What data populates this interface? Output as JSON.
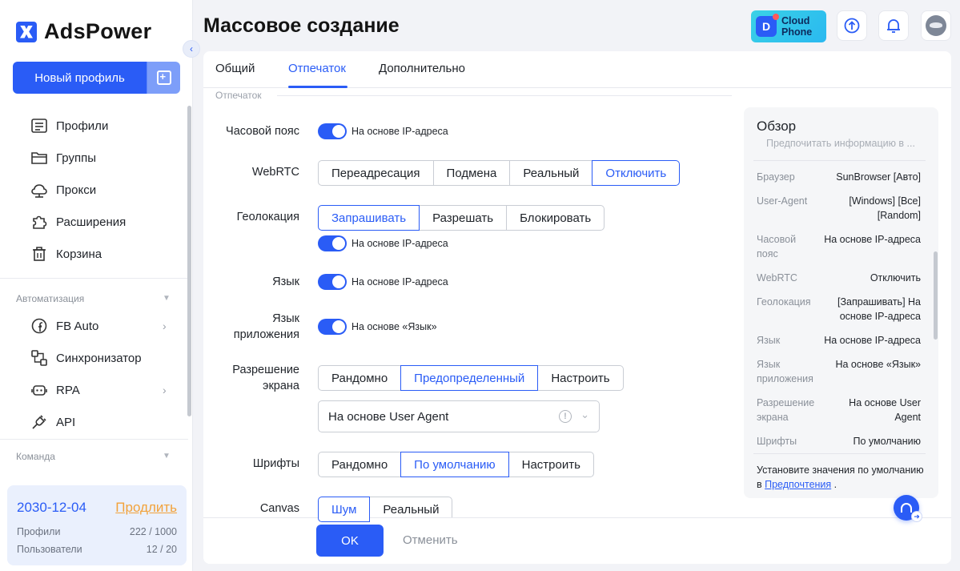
{
  "brand": {
    "name": "AdsPower"
  },
  "sidebar": {
    "new_profile_label": "Новый профиль",
    "items": [
      {
        "label": "Профили",
        "icon": "profiles-icon"
      },
      {
        "label": "Группы",
        "icon": "folder-icon"
      },
      {
        "label": "Прокси",
        "icon": "proxy-icon"
      },
      {
        "label": "Расширения",
        "icon": "puzzle-icon"
      },
      {
        "label": "Корзина",
        "icon": "trash-icon"
      }
    ],
    "automation_label": "Автоматизация",
    "automation_items": [
      {
        "label": "FB Auto",
        "icon": "facebook-icon"
      },
      {
        "label": "Синхронизатор",
        "icon": "sync-icon"
      },
      {
        "label": "RPA",
        "icon": "robot-icon"
      },
      {
        "label": "API",
        "icon": "plug-icon"
      }
    ],
    "team_label": "Команда",
    "plan": {
      "date": "2030-12-04",
      "renew": "Продлить",
      "profiles_label": "Профили",
      "profiles_value": "222 / 1000",
      "users_label": "Пользователи",
      "users_value": "12 / 20"
    }
  },
  "header": {
    "title": "Массовое создание",
    "cloud_phone_line1": "Cloud",
    "cloud_phone_line2": "Phone"
  },
  "tabs": [
    {
      "label": "Общий"
    },
    {
      "label": "Отпечаток",
      "active": true
    },
    {
      "label": "Дополнительно"
    }
  ],
  "section_legend": "Отпечаток",
  "form": {
    "timezone": {
      "label": "Часовой пояс",
      "toggle_label": "На основе IP-адреса",
      "on": true
    },
    "webrtc": {
      "label": "WebRTC",
      "options": [
        "Переадресация",
        "Подмена",
        "Реальный",
        "Отключить"
      ],
      "selected": "Отключить"
    },
    "geolocation": {
      "label": "Геолокация",
      "options": [
        "Запрашивать",
        "Разрешать",
        "Блокировать"
      ],
      "selected": "Запрашивать",
      "toggle_label": "На основе IP-адреса",
      "on": true
    },
    "language": {
      "label": "Язык",
      "toggle_label": "На основе IP-адреса",
      "on": true
    },
    "app_language": {
      "label_line1": "Язык",
      "label_line2": "приложения",
      "toggle_label": "На основе «Язык»",
      "on": true
    },
    "resolution": {
      "label_line1": "Разрешение",
      "label_line2": "экрана",
      "options": [
        "Рандомно",
        "Предопределенный",
        "Настроить"
      ],
      "selected": "Предопределенный",
      "select_value": "На основе User Agent"
    },
    "fonts": {
      "label": "Шрифты",
      "options": [
        "Рандомно",
        "По умолчанию",
        "Настроить"
      ],
      "selected": "По умолчанию"
    },
    "canvas": {
      "label": "Canvas",
      "options": [
        "Шум",
        "Реальный"
      ],
      "selected": "Шум"
    }
  },
  "overview": {
    "title": "Обзор",
    "search_placeholder": "Предпочитать информацию в ...",
    "rows": [
      {
        "key": "Браузер",
        "value": "SunBrowser [Авто]"
      },
      {
        "key": "User-Agent",
        "value": "[Windows] [Все] [Random]"
      },
      {
        "key": "Часовой пояс",
        "value": "На основе IP-адреса"
      },
      {
        "key": "WebRTC",
        "value": "Отключить"
      },
      {
        "key": "Геолокация",
        "value": "[Запрашивать] На основе IP-адреса"
      },
      {
        "key": "Язык",
        "value": "На основе IP-адреса"
      },
      {
        "key": "Язык приложения",
        "value": "На основе «Язык»"
      },
      {
        "key": "Разрешение экрана",
        "value": "На основе User Agent"
      },
      {
        "key": "Шрифты",
        "value": "По умолчанию"
      }
    ],
    "note_text": "Установите значения по умолчанию в",
    "note_link": "Предпочтения",
    "note_end": "."
  },
  "footer": {
    "ok_label": "OK",
    "cancel_label": "Отменить"
  },
  "colors": {
    "accent": "#2a5cf6",
    "renew": "#f2a23a"
  }
}
